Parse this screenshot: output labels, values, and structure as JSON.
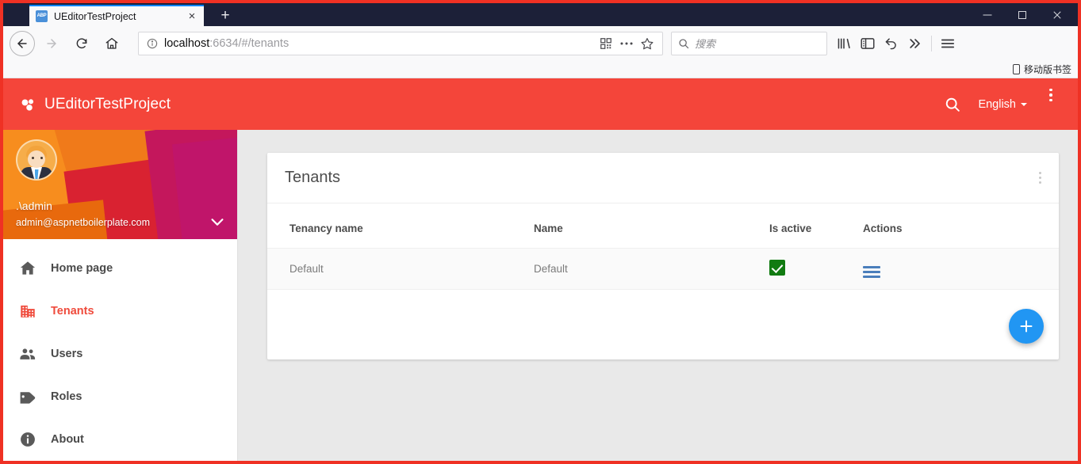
{
  "browser": {
    "tab": {
      "title": "UEditorTestProject",
      "favicon_label": "ABP",
      "favicon_name": "abp-favicon",
      "close_label": "×"
    },
    "newtab_label": "+",
    "window_controls": {
      "minimize": "minimize-button",
      "maximize": "maximize-button",
      "close": "close-button"
    },
    "url": {
      "host": "localhost",
      "rest": ":6634/#/tenants"
    },
    "search": {
      "placeholder": "搜索",
      "value": ""
    },
    "bookmarks": {
      "item_label": "移动版书签"
    }
  },
  "app_header": {
    "brand": "UEditorTestProject",
    "language": "English",
    "accent_color": "#f4453a"
  },
  "sidebar": {
    "profile": {
      "name": ".\\admin",
      "email": "admin@aspnetboilerplate.com"
    },
    "items": [
      {
        "label": "Home page",
        "icon": "home-icon",
        "active": false
      },
      {
        "label": "Tenants",
        "icon": "business-icon",
        "active": true
      },
      {
        "label": "Users",
        "icon": "people-icon",
        "active": false
      },
      {
        "label": "Roles",
        "icon": "tag-icon",
        "active": false
      },
      {
        "label": "About",
        "icon": "info-icon",
        "active": false
      }
    ],
    "active_color": "#ef4b3c"
  },
  "main": {
    "card": {
      "title": "Tenants",
      "columns": [
        "Tenancy name",
        "Name",
        "Is active",
        "Actions"
      ],
      "rows": [
        {
          "tenancy_name": "Default",
          "name": "Default",
          "is_active": true,
          "actions": "actions-menu"
        }
      ],
      "add_button_label": "+"
    }
  }
}
